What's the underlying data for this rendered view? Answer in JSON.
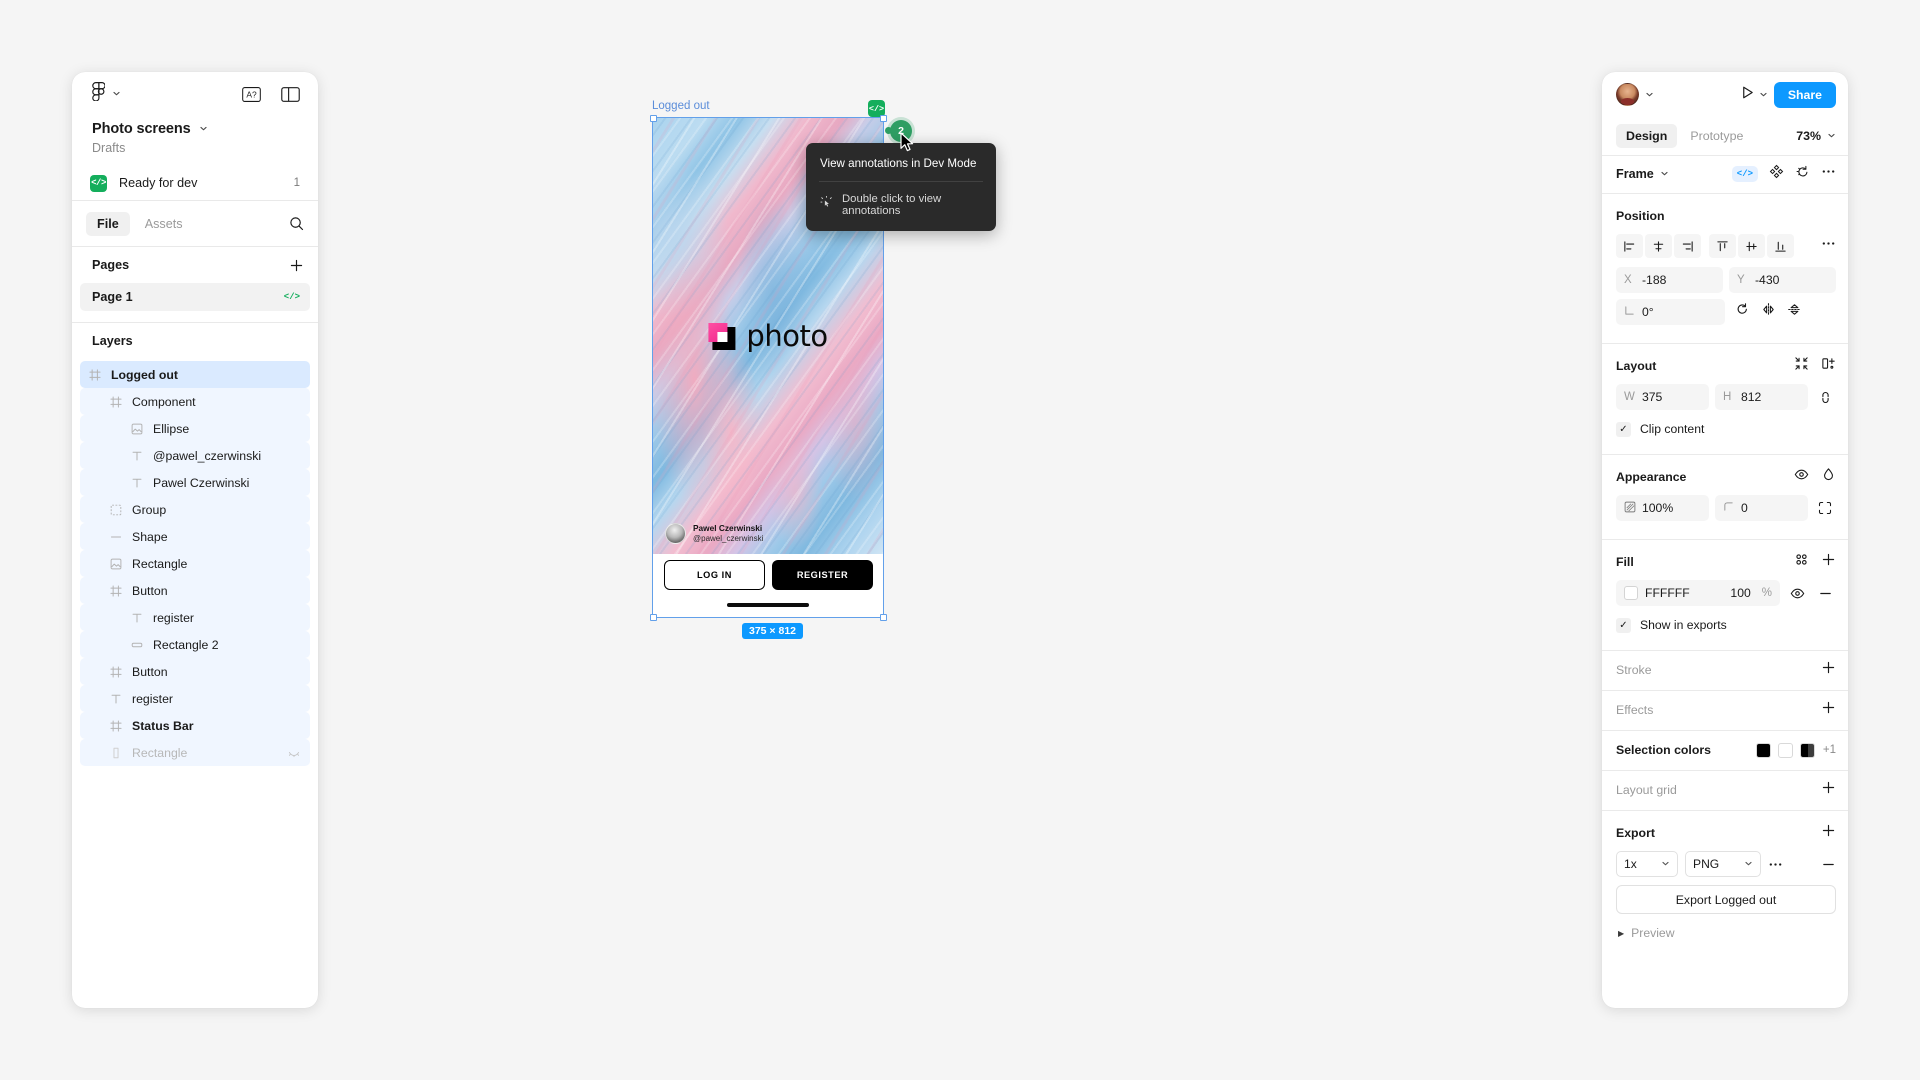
{
  "left_panel": {
    "figma_logo_icon": "figma-logo-icon",
    "menu_chevron_icon": "chevron-down-icon",
    "accessibility_icon": "A?",
    "layout_toggle_icon": "panel-toggle-icon",
    "file_title": "Photo screens",
    "file_title_chevron": "chevron-down-icon",
    "file_location": "Drafts",
    "ready_for_dev": {
      "badge_icon": "</>",
      "label": "Ready for dev",
      "count": "1"
    },
    "tabs": [
      {
        "label": "File",
        "active": true
      },
      {
        "label": "Assets",
        "active": false
      }
    ],
    "search_icon": "search-icon",
    "pages": {
      "title": "Pages",
      "add_icon": "plus-icon",
      "items": [
        {
          "label": "Page 1",
          "code_badge": "</>",
          "selected": true
        }
      ]
    },
    "layers": {
      "title": "Layers",
      "items": [
        {
          "label": "Logged out",
          "icon": "frame-icon",
          "indent": 0,
          "selected": true,
          "bold": true,
          "dim": false,
          "hidden_icon": false
        },
        {
          "label": "Component",
          "icon": "component-icon",
          "indent": 1,
          "selected": false,
          "bold": false,
          "dim": false,
          "hidden_icon": false
        },
        {
          "label": "Ellipse",
          "icon": "image-icon",
          "indent": 2,
          "selected": false,
          "bold": false,
          "dim": false,
          "hidden_icon": false
        },
        {
          "label": "@pawel_czerwinski",
          "icon": "text-icon",
          "indent": 2,
          "selected": false,
          "bold": false,
          "dim": false,
          "hidden_icon": false
        },
        {
          "label": "Pawel Czerwinski",
          "icon": "text-icon",
          "indent": 2,
          "selected": false,
          "bold": false,
          "dim": false,
          "hidden_icon": false
        },
        {
          "label": "Group",
          "icon": "group-icon",
          "indent": 1,
          "selected": false,
          "bold": false,
          "dim": false,
          "hidden_icon": false
        },
        {
          "label": "Shape",
          "icon": "line-icon",
          "indent": 1,
          "selected": false,
          "bold": false,
          "dim": false,
          "hidden_icon": false
        },
        {
          "label": "Rectangle",
          "icon": "image-icon",
          "indent": 1,
          "selected": false,
          "bold": false,
          "dim": false,
          "hidden_icon": false
        },
        {
          "label": "Button",
          "icon": "component-icon",
          "indent": 1,
          "selected": false,
          "bold": false,
          "dim": false,
          "hidden_icon": false
        },
        {
          "label": "register",
          "icon": "text-icon",
          "indent": 2,
          "selected": false,
          "bold": false,
          "dim": false,
          "hidden_icon": false
        },
        {
          "label": "Rectangle 2",
          "icon": "rect-icon",
          "indent": 2,
          "selected": false,
          "bold": false,
          "dim": false,
          "hidden_icon": false
        },
        {
          "label": "Button",
          "icon": "component-icon",
          "indent": 1,
          "selected": false,
          "bold": false,
          "dim": false,
          "hidden_icon": false
        },
        {
          "label": "register",
          "icon": "text-icon",
          "indent": 1,
          "selected": false,
          "bold": false,
          "dim": false,
          "hidden_icon": false
        },
        {
          "label": "Status Bar",
          "icon": "component-icon",
          "indent": 1,
          "selected": false,
          "bold": true,
          "dim": false,
          "hidden_icon": false
        },
        {
          "label": "Rectangle",
          "icon": "slice-icon",
          "indent": 1,
          "selected": false,
          "bold": false,
          "dim": true,
          "hidden_icon": true
        }
      ]
    }
  },
  "canvas": {
    "frame_label": "Logged out",
    "dev_badge_icon": "</>",
    "dimension_pill": "375 × 812",
    "annotation_count": "2",
    "artboard": {
      "logo_text": "photo",
      "logo_mark_icon": "photo-logo-icon",
      "author_name": "Pawel Czerwinski",
      "author_handle": "@pawel_czerwinski",
      "buttons": [
        {
          "label": "LOG IN",
          "style": "outline"
        },
        {
          "label": "REGISTER",
          "style": "filled"
        }
      ]
    },
    "tooltip": {
      "title": "View annotations in Dev Mode",
      "hint_icon": "click-icon",
      "hint": "Double click to view annotations"
    }
  },
  "right_panel": {
    "avatar_icon": "avatar",
    "avatar_chevron_icon": "chevron-down-icon",
    "present_icon": "play-icon",
    "present_chevron_icon": "chevron-down-icon",
    "share_label": "Share",
    "tabs": [
      {
        "label": "Design",
        "active": true
      },
      {
        "label": "Prototype",
        "active": false
      }
    ],
    "zoom_level": "73%",
    "zoom_chevron_icon": "chevron-down-icon",
    "node_type": {
      "label": "Frame",
      "chevron_icon": "chevron-down-icon",
      "actions": [
        "dev-mode-icon",
        "component-icon",
        "detach-icon",
        "more-icon"
      ]
    },
    "position": {
      "title": "Position",
      "align_icons": [
        "align-left-icon",
        "align-horizontal-center-icon",
        "align-right-icon",
        "align-top-icon",
        "align-vertical-center-icon",
        "align-bottom-icon"
      ],
      "more_icon": "more-icon",
      "x_key": "X",
      "x_value": "-188",
      "y_key": "Y",
      "y_value": "-430",
      "rotation_icon": "angle-icon",
      "rotation_value": "0°",
      "corner_icon": "corner-radius-icon",
      "flip_h_icon": "flip-horizontal-icon",
      "flip_v_icon": "flip-vertical-icon"
    },
    "layout": {
      "title": "Layout",
      "actions": [
        "resize-to-fit-icon",
        "add-auto-layout-icon"
      ],
      "w_key": "W",
      "w_value": "375",
      "h_key": "H",
      "h_value": "812",
      "ratio_icon": "lock-ratio-icon",
      "clip_content_label": "Clip content",
      "clip_content_checked": true
    },
    "appearance": {
      "title": "Appearance",
      "actions": [
        "visibility-icon",
        "blend-mode-icon"
      ],
      "opacity_icon": "opacity-icon",
      "opacity_value": "100%",
      "corner_icon": "corner-radius-icon",
      "corner_value": "0",
      "independent_corners_icon": "independent-corners-icon"
    },
    "fill": {
      "title": "Fill",
      "actions": [
        "styles-icon",
        "plus-icon"
      ],
      "swatch_color": "#FFFFFF",
      "hex": "FFFFFF",
      "opacity": "100",
      "opacity_unit": "%",
      "visibility_icon": "visibility-icon",
      "remove_icon": "minus-icon",
      "show_in_exports_label": "Show in exports",
      "show_in_exports_checked": true
    },
    "stroke": {
      "title": "Stroke",
      "add_icon": "plus-icon"
    },
    "effects": {
      "title": "Effects",
      "add_icon": "plus-icon"
    },
    "selection_colors": {
      "title": "Selection colors",
      "swatches": [
        "#000000",
        "#FFFFFF",
        "#1A1A1A"
      ],
      "more_label": "+1"
    },
    "layout_grid": {
      "title": "Layout grid",
      "add_icon": "plus-icon"
    },
    "export": {
      "title": "Export",
      "add_icon": "plus-icon",
      "scale": "1x",
      "format": "PNG",
      "more_icon": "more-icon",
      "remove_icon": "minus-icon",
      "button_label": "Export Logged out",
      "preview_label": "Preview",
      "preview_caret_icon": "caret-right-icon"
    }
  }
}
